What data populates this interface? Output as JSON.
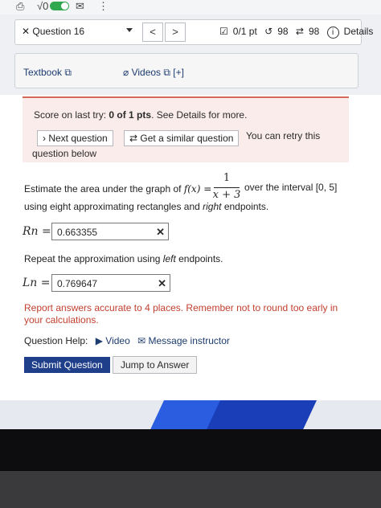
{
  "top": {
    "sqrt_label": "√0"
  },
  "nav": {
    "question_label": "✕  Question 16",
    "prev": "<",
    "next": ">",
    "points": "0/1 pt",
    "retries": "98",
    "attempts": "98",
    "details": "Details"
  },
  "resources": {
    "textbook": "Textbook ⧉",
    "videos": "Videos ⧉ [+]"
  },
  "score": {
    "prefix": "Score on last try: ",
    "bold": "0 of 1 pts",
    "suffix": ". See Details for more.",
    "next_question": "› Next question",
    "similar_question": "Get a similar question",
    "retry_text": "You can retry this",
    "retry_text2": "question below"
  },
  "question": {
    "line1a": "Estimate the area under the graph of",
    "func": "f(x) =",
    "numerator": "1",
    "denominator": "x + 3",
    "line1b": "over the interval [0, 5]",
    "line2a": "using eight approximating rectangles and ",
    "line2_em": "right",
    "line2b": " endpoints.",
    "rn_label": "Rn =",
    "rn_value": "0.663355",
    "repeat_a": "Repeat the approximation using ",
    "repeat_em": "left",
    "repeat_b": " endpoints.",
    "ln_label": "Ln =",
    "ln_value": "0.769647",
    "clear_symbol": "✕"
  },
  "warning": "Report answers accurate to 4 places. Remember not to round too early in your calculations.",
  "help": {
    "label": "Question Help:",
    "video": "▶ Video",
    "message": "✉ Message instructor"
  },
  "actions": {
    "submit": "Submit Question",
    "jump": "Jump to Answer"
  }
}
